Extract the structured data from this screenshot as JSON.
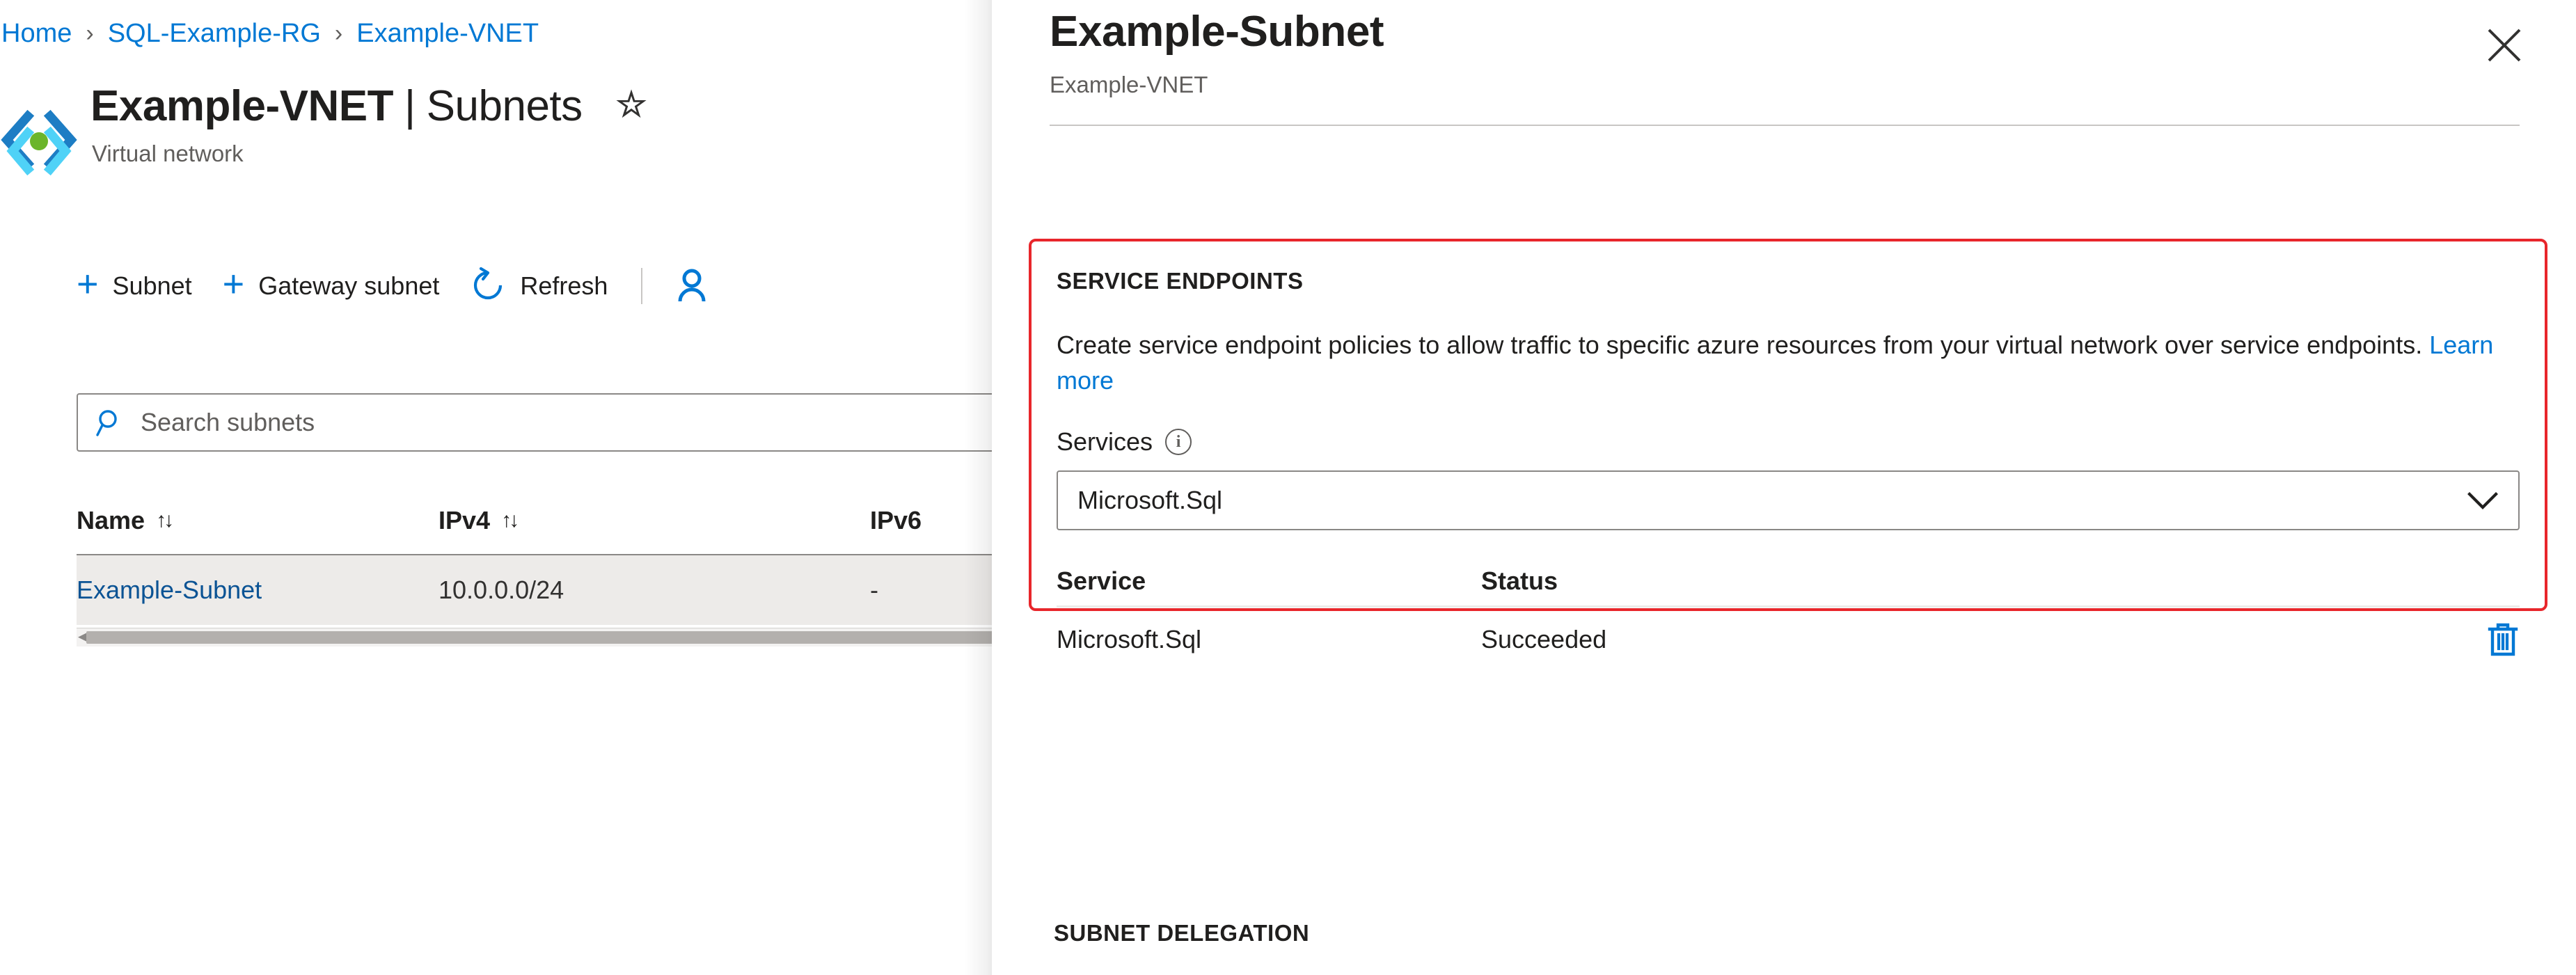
{
  "breadcrumb": {
    "items": [
      {
        "label": "Home"
      },
      {
        "label": "SQL-Example-RG"
      },
      {
        "label": "Example-VNET"
      }
    ],
    "separator": "›"
  },
  "header": {
    "title_resource": "Example-VNET",
    "title_separator": "|",
    "title_section": "Subnets",
    "subtitle": "Virtual network",
    "favorite_icon": "☆",
    "resource_icon": "virtual-network-icon"
  },
  "toolbar": {
    "commands": [
      {
        "label": "Subnet",
        "icon": "plus-icon"
      },
      {
        "label": "Gateway subnet",
        "icon": "plus-icon"
      },
      {
        "label": "Refresh",
        "icon": "refresh-icon"
      }
    ]
  },
  "search": {
    "placeholder": "Search subnets",
    "value": "",
    "icon": "search-icon"
  },
  "grid": {
    "columns": [
      {
        "label": "Name",
        "sort_icon": "↑↓"
      },
      {
        "label": "IPv4",
        "sort_icon": "↑↓"
      },
      {
        "label": "IPv6",
        "sort_icon": ""
      }
    ],
    "rows": [
      {
        "name": "Example-Subnet",
        "ipv4": "10.0.0.0/24",
        "ipv6": "-"
      }
    ]
  },
  "panel": {
    "title": "Example-Subnet",
    "subtitle": "Example-VNET",
    "close_icon": "close-icon"
  },
  "service_endpoints": {
    "heading": "SERVICE ENDPOINTS",
    "description_before_link": "Create service endpoint policies to allow traffic to specific azure resources from your virtual network over service endpoints. ",
    "link_label": "Learn more",
    "field_label": "Services",
    "field_info_icon": "info-icon",
    "selected_service": "Microsoft.Sql",
    "dropdown_icon": "chevron-down-icon",
    "table": {
      "columns": [
        "Service",
        "Status"
      ],
      "rows": [
        {
          "service": "Microsoft.Sql",
          "status": "Succeeded",
          "delete_icon": "delete-icon"
        }
      ]
    },
    "highlight_color": "#e8262b"
  },
  "subnet_delegation": {
    "heading": "SUBNET DELEGATION"
  },
  "colors": {
    "accent": "#0078d4",
    "link": "#0078d4",
    "grid_link": "#0b5394",
    "selected_row": "#edebe9",
    "text": "#201f1e",
    "muted": "#605e5c",
    "border": "#8a8886"
  }
}
